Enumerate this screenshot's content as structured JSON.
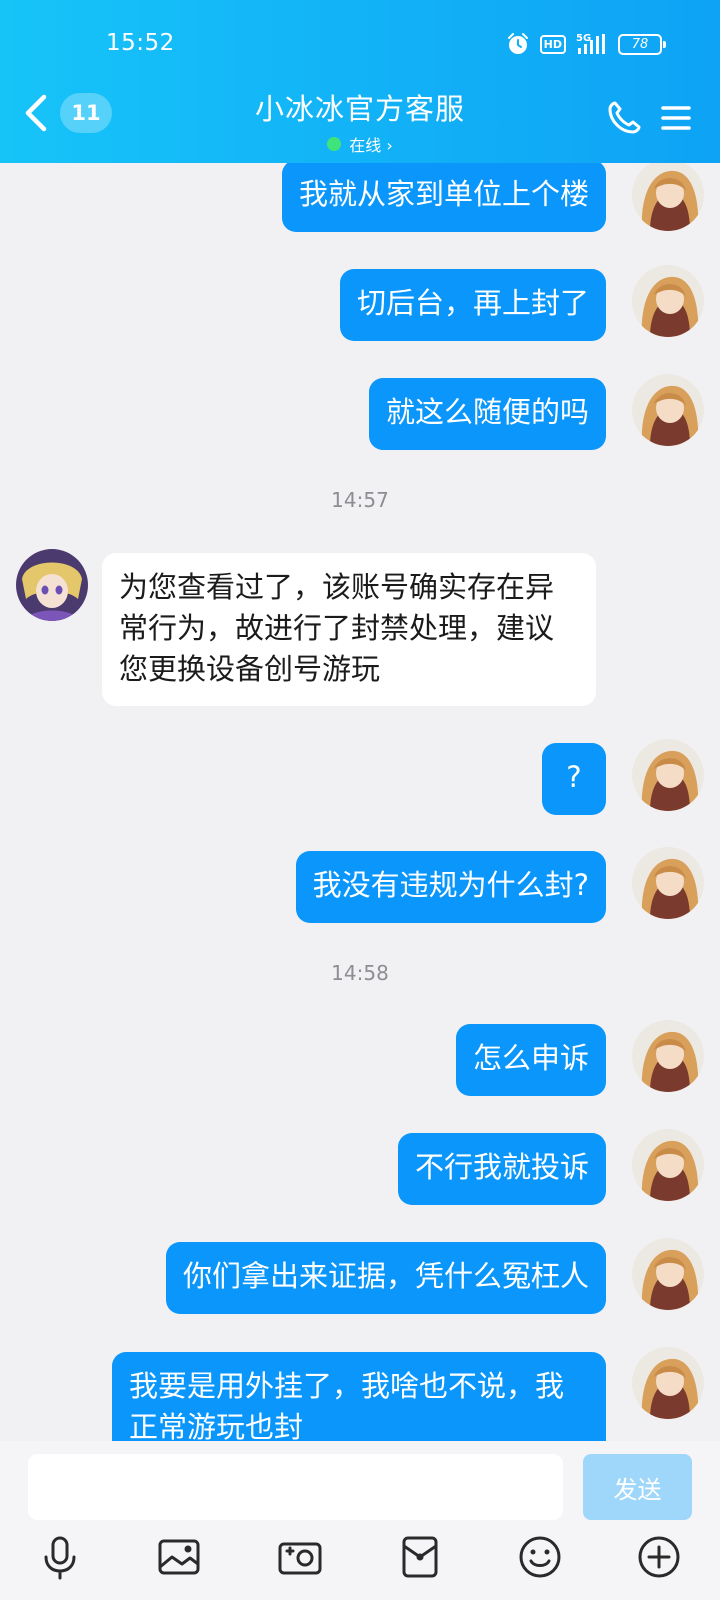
{
  "status_bar": {
    "time": "15:52",
    "hd": "HD",
    "network": "5G",
    "battery": "78"
  },
  "header": {
    "unread_count": "11",
    "title": "小冰冰官方客服",
    "presence": "在线 ›",
    "accent_color": "#12b1f7",
    "online_color": "#3fe37a"
  },
  "messages": [
    {
      "direction": "out",
      "text": "我就从家到单位上个楼"
    },
    {
      "direction": "out",
      "text": "切后台，再上封了"
    },
    {
      "direction": "out",
      "text": "就这么随便的吗"
    },
    {
      "timestamp": "14:57"
    },
    {
      "direction": "in",
      "lines": [
        "为您查看过了，该账号确实存在异",
        "常行为，故进行了封禁处理，建议",
        "您更换设备创号游玩"
      ]
    },
    {
      "direction": "out",
      "text": "?"
    },
    {
      "direction": "out",
      "text": "我没有违规为什么封?"
    },
    {
      "timestamp": "14:58"
    },
    {
      "direction": "out",
      "text": "怎么申诉"
    },
    {
      "direction": "out",
      "text": "不行我就投诉"
    },
    {
      "direction": "out",
      "text": "你们拿出来证据，凭什么冤枉人"
    },
    {
      "direction": "out",
      "lines": [
        "我要是用外挂了，我啥也不说，我",
        "正常游玩也封"
      ]
    }
  ],
  "input": {
    "value": "",
    "send_label": "发送"
  },
  "toolbar": [
    "microphone-icon",
    "image-icon",
    "camera-icon",
    "red-packet-icon",
    "emoji-icon",
    "plus-icon"
  ],
  "colors": {
    "outgoing_bubble": "#0a96fa",
    "incoming_bubble": "#ffffff",
    "send_button": "#9fd7fb"
  }
}
